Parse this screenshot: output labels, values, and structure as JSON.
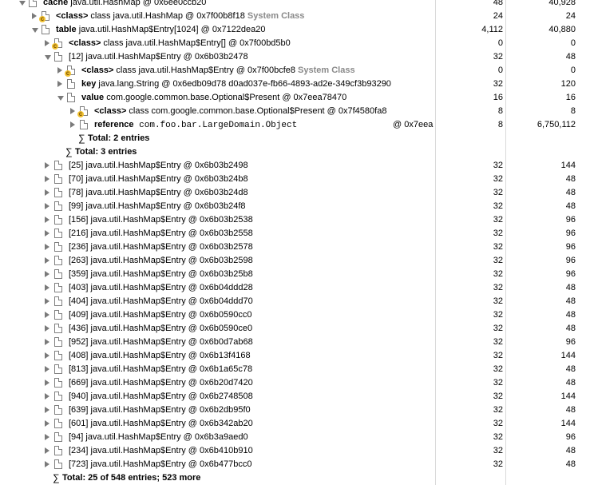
{
  "rows": [
    {
      "indent": 0,
      "toggle": "expanded",
      "icon": "file",
      "badge": "none",
      "label": "cache",
      "text": " java.util.HashMap @ 0x6ee0ccb20",
      "sys": "",
      "shallow": "48",
      "retained": "40,928"
    },
    {
      "indent": 1,
      "toggle": "collapsed",
      "icon": "file",
      "badge": "class",
      "label": "<class>",
      "text": " class java.util.HashMap @ 0x7f00b8f18 ",
      "sys": "System Class",
      "shallow": "24",
      "retained": "24"
    },
    {
      "indent": 1,
      "toggle": "expanded",
      "icon": "file",
      "badge": "none",
      "label": "table",
      "text": " java.util.HashMap$Entry[1024] @ 0x7122dea20",
      "sys": "",
      "shallow": "4,112",
      "retained": "40,880"
    },
    {
      "indent": 2,
      "toggle": "collapsed",
      "icon": "file",
      "badge": "class",
      "label": "<class>",
      "text": " class java.util.HashMap$Entry[] @ 0x7f00bd5b0",
      "sys": "",
      "shallow": "0",
      "retained": "0"
    },
    {
      "indent": 2,
      "toggle": "expanded",
      "icon": "file",
      "badge": "none",
      "label": "",
      "text": "[12] java.util.HashMap$Entry @ 0x6b03b2478",
      "sys": "",
      "shallow": "32",
      "retained": "48"
    },
    {
      "indent": 3,
      "toggle": "collapsed",
      "icon": "file",
      "badge": "class",
      "label": "<class>",
      "text": " class java.util.HashMap$Entry @ 0x7f00bcfe8 ",
      "sys": "System Class",
      "shallow": "0",
      "retained": "0"
    },
    {
      "indent": 3,
      "toggle": "collapsed",
      "icon": "file",
      "badge": "none",
      "label": "key",
      "text": " java.lang.String @ 0x6edb09d78  d0ad037e-fb66-4893-ad2e-349cf3b93290",
      "sys": "",
      "shallow": "32",
      "retained": "120"
    },
    {
      "indent": 3,
      "toggle": "expanded",
      "icon": "file",
      "badge": "none",
      "label": "value",
      "text": " com.google.common.base.Optional$Present @ 0x7eea78470",
      "sys": "",
      "shallow": "16",
      "retained": "16"
    },
    {
      "indent": 4,
      "toggle": "collapsed",
      "icon": "file",
      "badge": "class",
      "label": "<class>",
      "text": " class com.google.common.base.Optional$Present @ 0x7f4580fa8",
      "sys": "",
      "shallow": "8",
      "retained": "8"
    },
    {
      "indent": 4,
      "toggle": "collapsed",
      "icon": "file",
      "badge": "none",
      "label": "reference",
      "text": " com.foo.bar.LargeDomain.Object",
      "mono": true,
      "addr2": "@ 0x7eea",
      "sys": "",
      "shallow": "8",
      "retained": "6,750,112"
    },
    {
      "indent": 4,
      "toggle": "none",
      "icon": "sigma",
      "badge": "none",
      "label": "Total: 2 entries",
      "text": "",
      "sys": "",
      "shallow": "",
      "retained": ""
    },
    {
      "indent": 3,
      "toggle": "none",
      "icon": "sigma",
      "badge": "none",
      "label": "Total: 3 entries",
      "text": "",
      "sys": "",
      "shallow": "",
      "retained": ""
    },
    {
      "indent": 2,
      "toggle": "collapsed",
      "icon": "file",
      "badge": "none",
      "label": "",
      "text": "[25] java.util.HashMap$Entry @ 0x6b03b2498",
      "sys": "",
      "shallow": "32",
      "retained": "144"
    },
    {
      "indent": 2,
      "toggle": "collapsed",
      "icon": "file",
      "badge": "none",
      "label": "",
      "text": "[70] java.util.HashMap$Entry @ 0x6b03b24b8",
      "sys": "",
      "shallow": "32",
      "retained": "48"
    },
    {
      "indent": 2,
      "toggle": "collapsed",
      "icon": "file",
      "badge": "none",
      "label": "",
      "text": "[78] java.util.HashMap$Entry @ 0x6b03b24d8",
      "sys": "",
      "shallow": "32",
      "retained": "48"
    },
    {
      "indent": 2,
      "toggle": "collapsed",
      "icon": "file",
      "badge": "none",
      "label": "",
      "text": "[99] java.util.HashMap$Entry @ 0x6b03b24f8",
      "sys": "",
      "shallow": "32",
      "retained": "48"
    },
    {
      "indent": 2,
      "toggle": "collapsed",
      "icon": "file",
      "badge": "none",
      "label": "",
      "text": "[156] java.util.HashMap$Entry @ 0x6b03b2538",
      "sys": "",
      "shallow": "32",
      "retained": "96"
    },
    {
      "indent": 2,
      "toggle": "collapsed",
      "icon": "file",
      "badge": "none",
      "label": "",
      "text": "[216] java.util.HashMap$Entry @ 0x6b03b2558",
      "sys": "",
      "shallow": "32",
      "retained": "96"
    },
    {
      "indent": 2,
      "toggle": "collapsed",
      "icon": "file",
      "badge": "none",
      "label": "",
      "text": "[236] java.util.HashMap$Entry @ 0x6b03b2578",
      "sys": "",
      "shallow": "32",
      "retained": "96"
    },
    {
      "indent": 2,
      "toggle": "collapsed",
      "icon": "file",
      "badge": "none",
      "label": "",
      "text": "[263] java.util.HashMap$Entry @ 0x6b03b2598",
      "sys": "",
      "shallow": "32",
      "retained": "96"
    },
    {
      "indent": 2,
      "toggle": "collapsed",
      "icon": "file",
      "badge": "none",
      "label": "",
      "text": "[359] java.util.HashMap$Entry @ 0x6b03b25b8",
      "sys": "",
      "shallow": "32",
      "retained": "96"
    },
    {
      "indent": 2,
      "toggle": "collapsed",
      "icon": "file",
      "badge": "none",
      "label": "",
      "text": "[403] java.util.HashMap$Entry @ 0x6b04ddd28",
      "sys": "",
      "shallow": "32",
      "retained": "48"
    },
    {
      "indent": 2,
      "toggle": "collapsed",
      "icon": "file",
      "badge": "none",
      "label": "",
      "text": "[404] java.util.HashMap$Entry @ 0x6b04ddd70",
      "sys": "",
      "shallow": "32",
      "retained": "48"
    },
    {
      "indent": 2,
      "toggle": "collapsed",
      "icon": "file",
      "badge": "none",
      "label": "",
      "text": "[409] java.util.HashMap$Entry @ 0x6b0590cc0",
      "sys": "",
      "shallow": "32",
      "retained": "48"
    },
    {
      "indent": 2,
      "toggle": "collapsed",
      "icon": "file",
      "badge": "none",
      "label": "",
      "text": "[436] java.util.HashMap$Entry @ 0x6b0590ce0",
      "sys": "",
      "shallow": "32",
      "retained": "48"
    },
    {
      "indent": 2,
      "toggle": "collapsed",
      "icon": "file",
      "badge": "none",
      "label": "",
      "text": "[952] java.util.HashMap$Entry @ 0x6b0d7ab68",
      "sys": "",
      "shallow": "32",
      "retained": "96"
    },
    {
      "indent": 2,
      "toggle": "collapsed",
      "icon": "file",
      "badge": "none",
      "label": "",
      "text": "[408] java.util.HashMap$Entry @ 0x6b13f4168",
      "sys": "",
      "shallow": "32",
      "retained": "144"
    },
    {
      "indent": 2,
      "toggle": "collapsed",
      "icon": "file",
      "badge": "none",
      "label": "",
      "text": "[813] java.util.HashMap$Entry @ 0x6b1a65c78",
      "sys": "",
      "shallow": "32",
      "retained": "48"
    },
    {
      "indent": 2,
      "toggle": "collapsed",
      "icon": "file",
      "badge": "none",
      "label": "",
      "text": "[669] java.util.HashMap$Entry @ 0x6b20d7420",
      "sys": "",
      "shallow": "32",
      "retained": "48"
    },
    {
      "indent": 2,
      "toggle": "collapsed",
      "icon": "file",
      "badge": "none",
      "label": "",
      "text": "[940] java.util.HashMap$Entry @ 0x6b2748508",
      "sys": "",
      "shallow": "32",
      "retained": "144"
    },
    {
      "indent": 2,
      "toggle": "collapsed",
      "icon": "file",
      "badge": "none",
      "label": "",
      "text": "[639] java.util.HashMap$Entry @ 0x6b2db95f0",
      "sys": "",
      "shallow": "32",
      "retained": "48"
    },
    {
      "indent": 2,
      "toggle": "collapsed",
      "icon": "file",
      "badge": "none",
      "label": "",
      "text": "[601] java.util.HashMap$Entry @ 0x6b342ab20",
      "sys": "",
      "shallow": "32",
      "retained": "144"
    },
    {
      "indent": 2,
      "toggle": "collapsed",
      "icon": "file",
      "badge": "none",
      "label": "",
      "text": "[94] java.util.HashMap$Entry @ 0x6b3a9aed0",
      "sys": "",
      "shallow": "32",
      "retained": "96"
    },
    {
      "indent": 2,
      "toggle": "collapsed",
      "icon": "file",
      "badge": "none",
      "label": "",
      "text": "[234] java.util.HashMap$Entry @ 0x6b410b910",
      "sys": "",
      "shallow": "32",
      "retained": "48"
    },
    {
      "indent": 2,
      "toggle": "collapsed",
      "icon": "file",
      "badge": "none",
      "label": "",
      "text": "[723] java.util.HashMap$Entry @ 0x6b477bcc0",
      "sys": "",
      "shallow": "32",
      "retained": "48"
    },
    {
      "indent": 2,
      "toggle": "none",
      "icon": "sigma-plus",
      "badge": "none",
      "label": "Total: 25 of 548 entries; 523 more",
      "text": "",
      "sys": "",
      "shallow": "",
      "retained": ""
    }
  ]
}
